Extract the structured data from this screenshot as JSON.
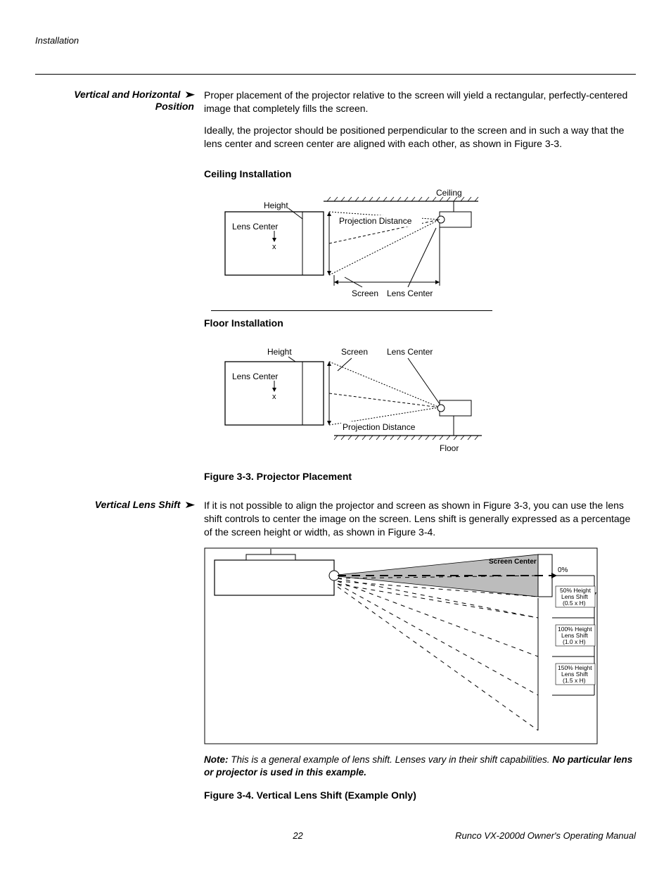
{
  "header": {
    "section": "Installation"
  },
  "sections": {
    "verticalHorizontal": {
      "label_line1": "Vertical and Horizontal",
      "label_line2": "Position",
      "para1": "Proper placement of the projector relative to the screen will yield a rectangular, perfectly-centered image that completely fills the screen.",
      "para2": "Ideally, the projector should be positioned perpendicular to the screen and in such a way that the lens center and screen center are aligned with each other, as shown in Figure 3-3."
    },
    "figure33": {
      "ceiling_title": "Ceiling Installation",
      "floor_title": "Floor Installation",
      "caption": "Figure 3-3. Projector Placement",
      "labels": {
        "ceiling": "Ceiling",
        "height": "Height",
        "lens_center": "Lens Center",
        "projection_distance": "Projection Distance",
        "screen": "Screen",
        "floor": "Floor"
      }
    },
    "verticalLensShift": {
      "label": "Vertical Lens Shift",
      "para": "If it is not possible to align the projector and screen as shown in Figure 3-3, you can use the lens shift controls to center the image on the screen. Lens shift is generally expressed as a percentage of the screen height or width, as shown in Figure 3-4."
    },
    "figure34": {
      "screen_center": "Screen Center",
      "zero": "0%",
      "shift50_1": "50% Height",
      "shift50_2": "Lens Shift",
      "shift50_3": "(0.5 x H)",
      "shift100_1": "100% Height",
      "shift100_2": "Lens Shift",
      "shift100_3": "(1.0 x H)",
      "shift150_1": "150% Height",
      "shift150_2": "Lens Shift",
      "shift150_3": "(1.5 x H)",
      "note_prefix": "Note:",
      "note_body": " This is a general example of lens shift. Lenses vary in their shift capabilities. ",
      "note_bold": "No particular lens or projector is used in this example.",
      "caption": "Figure 3-4. Vertical Lens Shift (Example Only)"
    }
  },
  "footer": {
    "page": "22",
    "manual": "Runco VX-2000d Owner's Operating Manual"
  },
  "chart_data": {
    "type": "table",
    "title": "Vertical Lens Shift percentages",
    "columns": [
      "label",
      "shift_percent",
      "offset_multiple_of_H"
    ],
    "rows": [
      [
        "Screen Center",
        0,
        0.0
      ],
      [
        "50% Height Lens Shift",
        50,
        0.5
      ],
      [
        "100% Height Lens Shift",
        100,
        1.0
      ],
      [
        "150% Height Lens Shift",
        150,
        1.5
      ]
    ]
  }
}
